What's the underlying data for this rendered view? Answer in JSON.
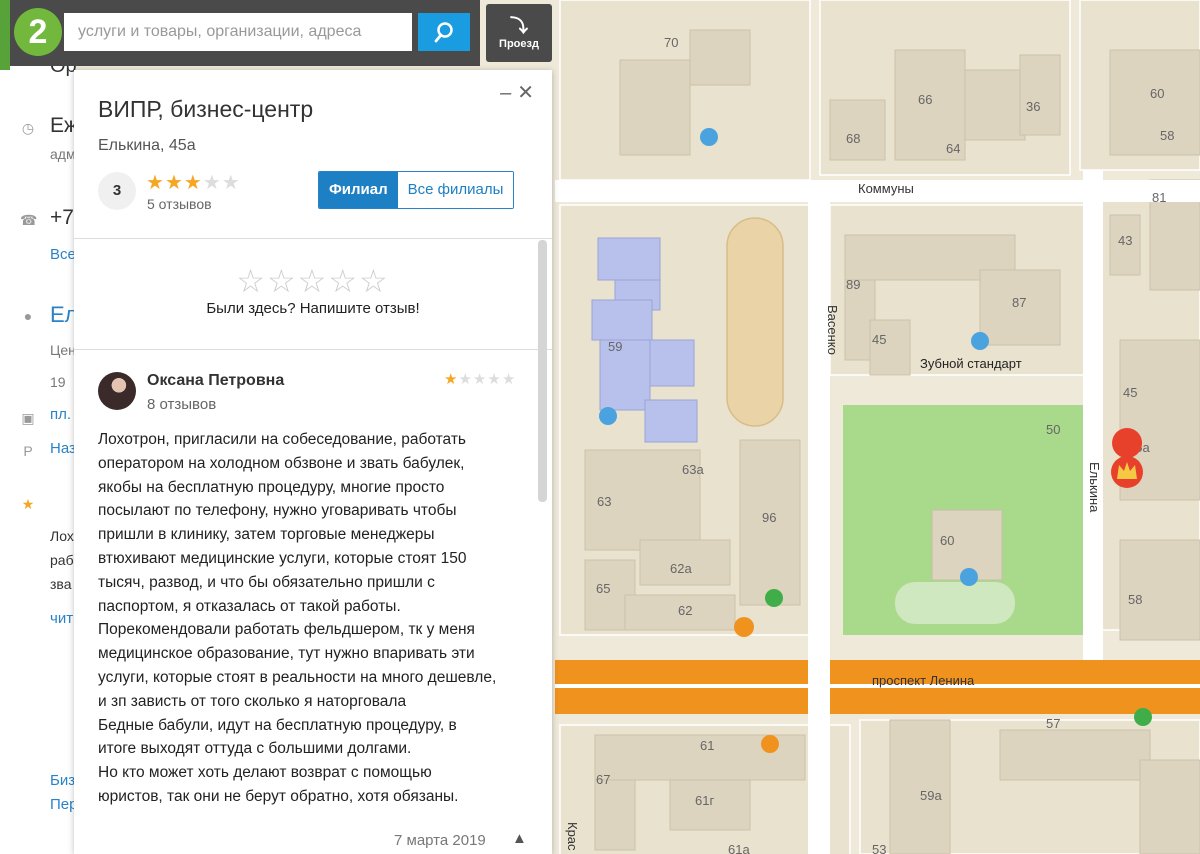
{
  "search": {
    "placeholder": "услуги и товары, организации, адреса",
    "route_label": "Проезд"
  },
  "background_panel": {
    "items": [
      {
        "text": "Ор",
        "type": "title"
      },
      {
        "text": "Еж",
        "type": "text"
      },
      {
        "text": "адм",
        "type": "sub"
      },
      {
        "text": "+7",
        "type": "text"
      },
      {
        "text": "Все",
        "type": "link"
      },
      {
        "text": "Ел",
        "type": "title-link"
      },
      {
        "text": "Цен",
        "type": "sub"
      },
      {
        "text": "19",
        "type": "sub"
      },
      {
        "text": "пл.",
        "type": "link"
      },
      {
        "text": "Наз",
        "type": "link"
      },
      {
        "text": "Лох",
        "type": "sub"
      },
      {
        "text": "раб",
        "type": "sub"
      },
      {
        "text": "зва",
        "type": "sub"
      },
      {
        "text": "чит",
        "type": "link"
      },
      {
        "text": "Биз",
        "type": "link"
      },
      {
        "text": "Пер",
        "type": "link"
      }
    ]
  },
  "card": {
    "title": "ВИПР, бизнес-центр",
    "address": "Елькина, 45а",
    "rating_value": "3",
    "rating_stars": 3,
    "reviews_count": "5 отзывов",
    "tabs": [
      {
        "label": "Филиал",
        "active": true
      },
      {
        "label": "Все филиалы",
        "active": false
      }
    ],
    "empty_stars": "☆☆☆☆☆",
    "write_prompt": "Были здесь? Напишите отзыв!",
    "review": {
      "author": "Оксана Петровна",
      "author_reviews": "8 отзывов",
      "rating": 1,
      "lines": [
        "Лохотрон, пригласили на собеседование, работать",
        "оператором на холодном обзвоне и звать бабулек,",
        "якобы на бесплатную процедуру, многие просто",
        "посылают по телефону, нужно уговаривать чтобы",
        "пришли в клинику, затем торговые менеджеры",
        "втюхивают медицинские услуги, которые стоят 150",
        "тысяч, развод, и что бы обязательно пришли с",
        "паспортом, я отказалась от такой работы.",
        "Порекомендовали работать фельдшером, тк у меня",
        "медицинское образование, тут нужно впаривать эти",
        "услуги, которые стоят в реальности на много дешевле,",
        "и зп зависть от того сколько я наторговала",
        "Бедные бабули, идут на бесплатную процедуру, в",
        "итоге выходят оттуда с большими долгами.",
        "Но кто может хоть делают возврат с помощью",
        "юристов, так они не берут обратно, хотя обязаны."
      ],
      "date": "7 марта 2019"
    }
  },
  "map": {
    "streets": [
      "Коммуны",
      "Васенко",
      "Елькина",
      "проспект Ленина",
      "Крас"
    ],
    "house_numbers": [
      "70",
      "66",
      "36",
      "60",
      "58",
      "68",
      "64",
      "81",
      "43",
      "89",
      "87",
      "59",
      "45",
      "45",
      "50",
      "45а",
      "63а",
      "63",
      "96",
      "60",
      "62а",
      "65",
      "62",
      "58",
      "57",
      "61",
      "67",
      "61г",
      "59а",
      "61а",
      "53"
    ],
    "pois": [
      "Зубной стандарт"
    ],
    "colors": {
      "avenue": "#f0921e",
      "park": "#a9d98a",
      "building": "#ddd4c0",
      "stadium": "#ead3a6",
      "marker": "#e8412b"
    }
  }
}
